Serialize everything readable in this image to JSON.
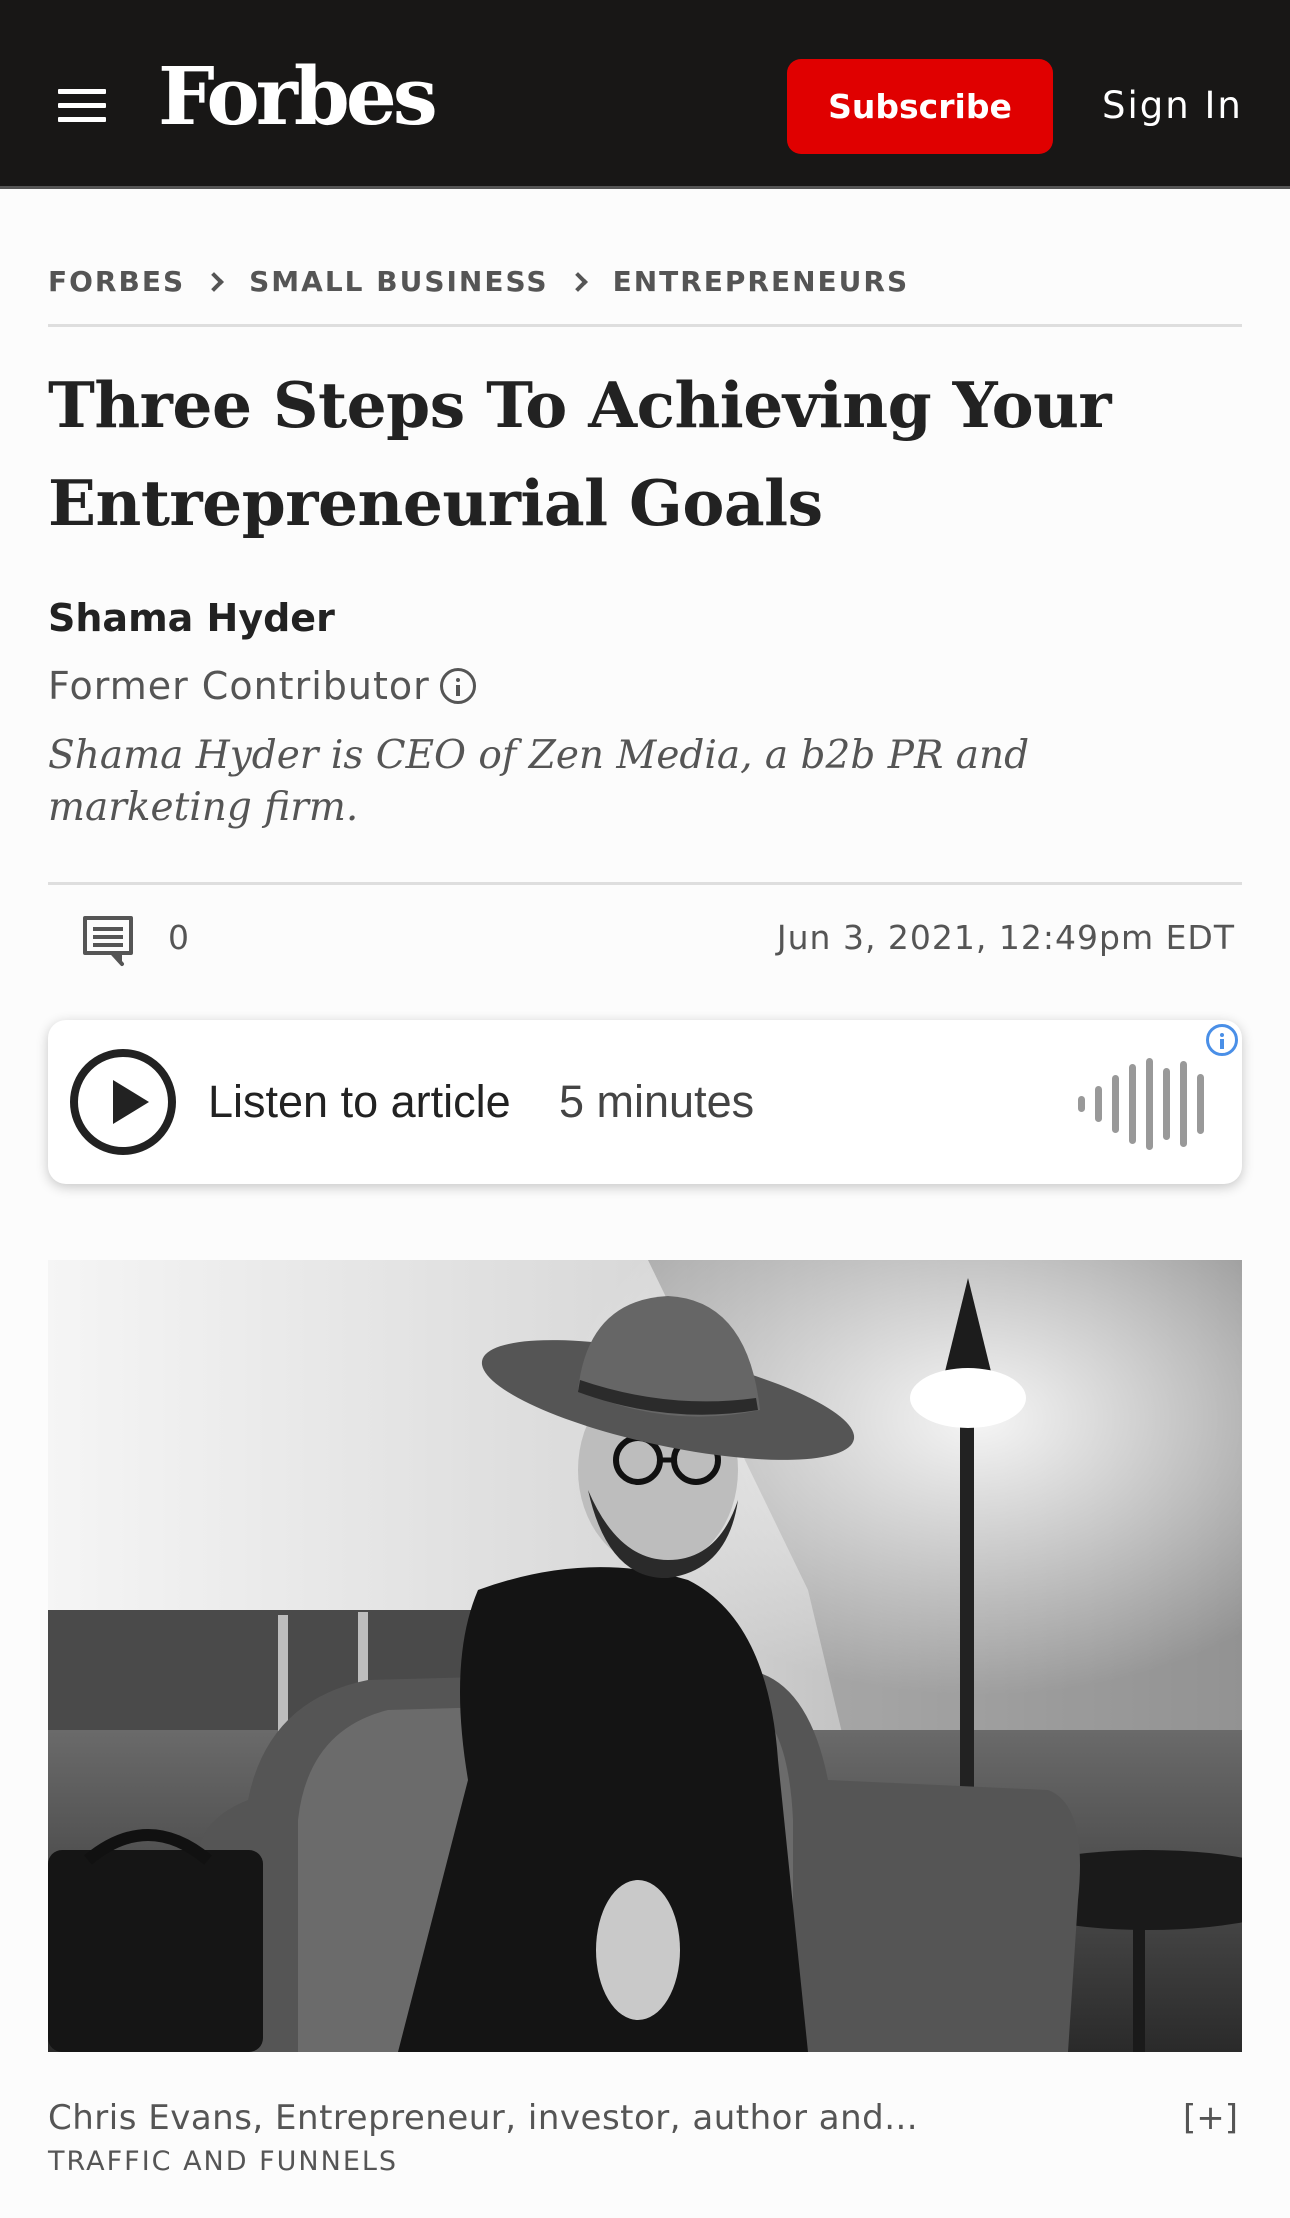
{
  "header": {
    "logo": "Forbes",
    "subscribe_label": "Subscribe",
    "signin_label": "Sign In"
  },
  "breadcrumb": [
    "FORBES",
    "SMALL BUSINESS",
    "ENTREPRENEURS"
  ],
  "article": {
    "title_line1": "Three Steps To Achieving Your",
    "title_line2": "Entrepreneurial Goals",
    "author": "Shama Hyder",
    "role": "Former Contributor",
    "bio": "Shama Hyder is CEO of Zen Media, a b2b PR and marketing firm.",
    "comment_count": "0",
    "date": "Jun 3, 2021, 12:49pm EDT"
  },
  "audio": {
    "listen_label": "Listen to article",
    "duration": "5 minutes"
  },
  "image": {
    "caption": "Chris Evans, Entrepreneur, investor, author and...",
    "expand_label": "[+]",
    "credit": "TRAFFIC AND FUNNELS"
  },
  "icons": {
    "menu": "hamburger-menu-icon",
    "comment": "comment-icon",
    "info": "info-icon",
    "play": "play-icon",
    "waveform": "audio-waveform-icon"
  },
  "colors": {
    "header_bg": "#181716",
    "subscribe_bg": "#e00000",
    "text_primary": "#222222",
    "text_secondary": "#555555",
    "player_info": "#4a8fe7"
  }
}
